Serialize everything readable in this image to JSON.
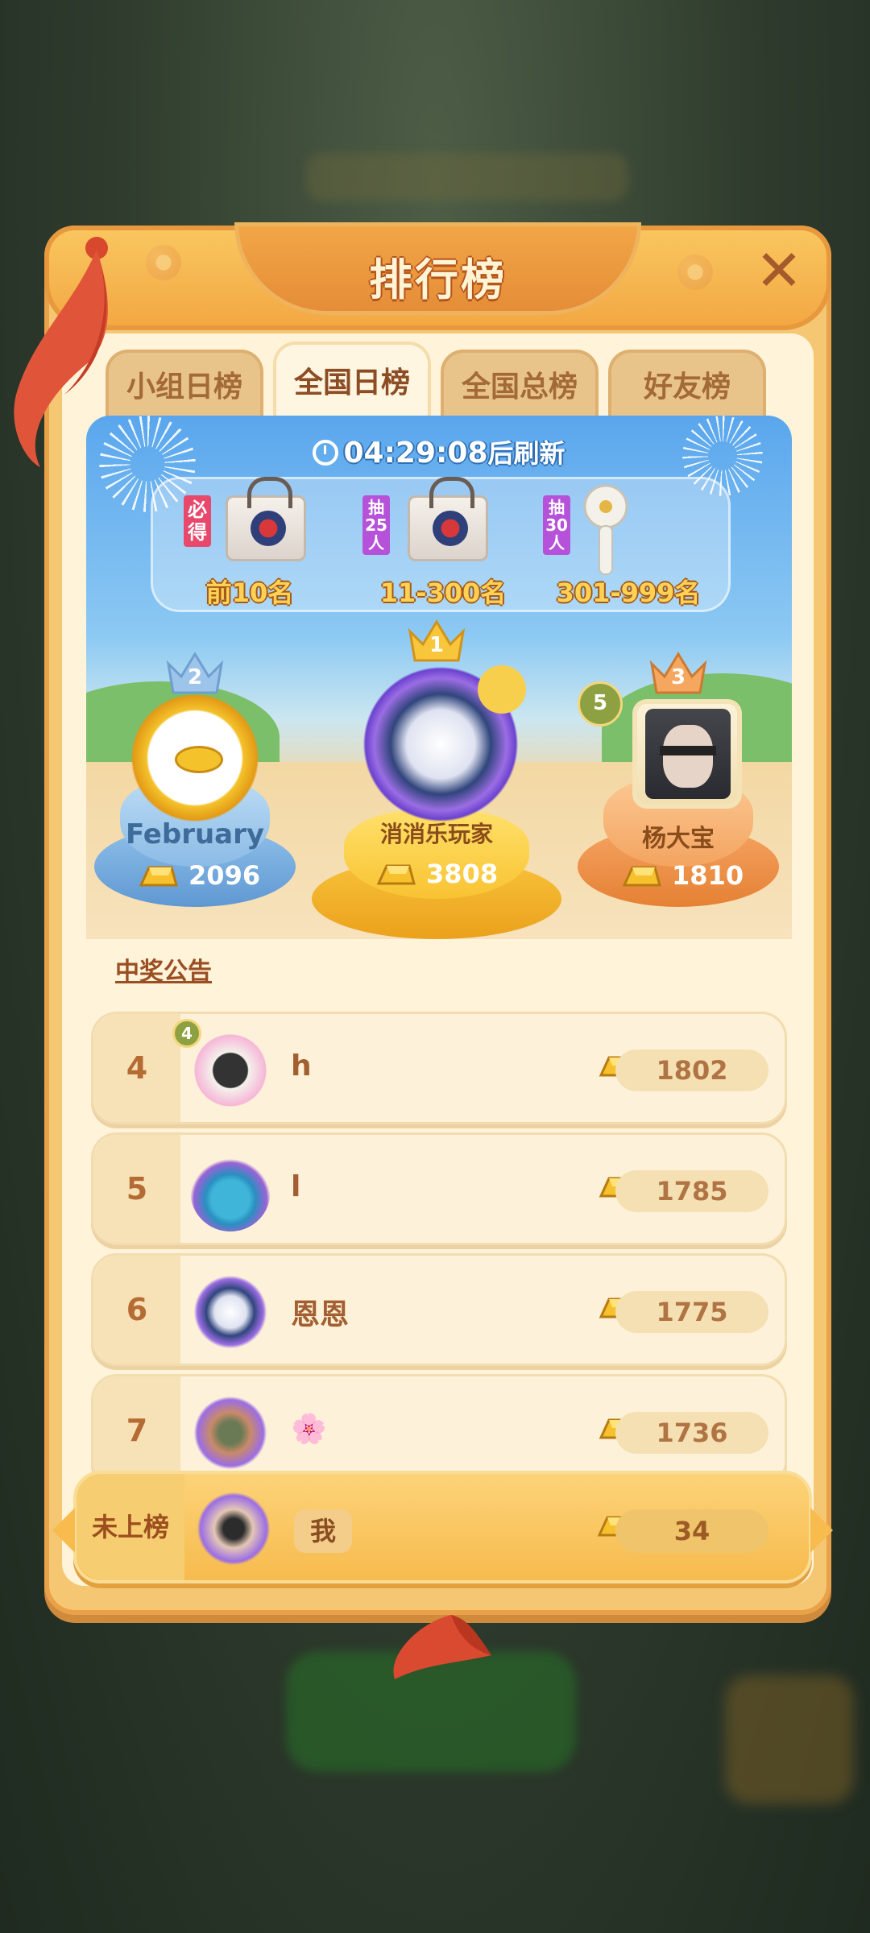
{
  "header": {
    "title": "排行榜"
  },
  "tabs": [
    {
      "label": "小组日榜",
      "active": false
    },
    {
      "label": "全国日榜",
      "active": true
    },
    {
      "label": "全国总榜",
      "active": false
    },
    {
      "label": "好友榜",
      "active": false
    }
  ],
  "timer": {
    "time": "04:29:08",
    "suffix": "后刷新"
  },
  "prizes": [
    {
      "tag": "必得",
      "label": "前10名",
      "icon": "tote-bag-icon"
    },
    {
      "tag": "抽25人",
      "label": "11-300名",
      "icon": "tote-bag-icon"
    },
    {
      "tag": "抽30人",
      "label": "301-999名",
      "icon": "handheld-fan-icon"
    }
  ],
  "podium": [
    {
      "rank": "1",
      "name": "消消乐玩家",
      "score": "3808"
    },
    {
      "rank": "2",
      "name": "February",
      "score": "2096"
    },
    {
      "rank": "3",
      "name": "杨大宝",
      "score": "1810",
      "level": "5"
    }
  ],
  "notice": "中奖公告",
  "rows": [
    {
      "rank": "4",
      "name": "h",
      "score": "1802",
      "level": "4"
    },
    {
      "rank": "5",
      "name": "l",
      "score": "1785"
    },
    {
      "rank": "6",
      "name": "恩恩",
      "score": "1775"
    },
    {
      "rank": "7",
      "name": "🌸",
      "score": "1736"
    }
  ],
  "me": {
    "rank_label": "未上榜",
    "name": "我",
    "score": "34"
  },
  "colors": {
    "accent": "#f3a843",
    "gold": "#ffd257",
    "sky": "#5aa6ed"
  }
}
